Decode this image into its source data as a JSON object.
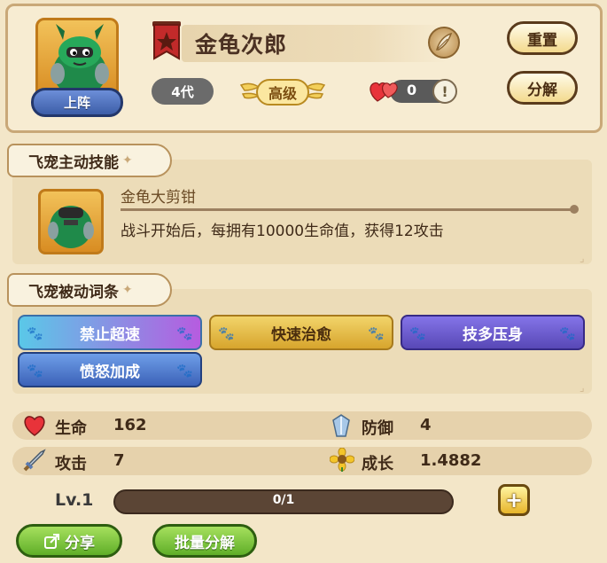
{
  "pet": {
    "name": "金龟次郎",
    "generation": "4代",
    "grade": "高级",
    "hearts": "0",
    "info_symbol": "!"
  },
  "buttons": {
    "deploy": "上阵",
    "reset": "重置",
    "decompose": "分解",
    "share": "分享",
    "batch_decompose": "批量分解",
    "plus": "+"
  },
  "active_skill": {
    "section_title": "飞宠主动技能",
    "name": "金龟大剪钳",
    "description": "战斗开始后，每拥有10000生命值，获得12攻击"
  },
  "passive": {
    "section_title": "飞宠被动词条",
    "traits": [
      {
        "label": "禁止超速",
        "style": "cyan-purple"
      },
      {
        "label": "快速治愈",
        "style": "gold"
      },
      {
        "label": "技多压身",
        "style": "purple"
      },
      {
        "label": "愤怒加成",
        "style": "blue"
      }
    ]
  },
  "stats": {
    "hp_label": "生命",
    "hp_value": "162",
    "def_label": "防御",
    "def_value": "4",
    "atk_label": "攻击",
    "atk_value": "7",
    "growth_label": "成长",
    "growth_value": "1.4882"
  },
  "level": {
    "label": "Lv.1",
    "progress_text": "0/1",
    "progress_fraction": 0
  },
  "colors": {
    "background": "#f3e6c8",
    "panel": "#ecdcb8",
    "accent_gold": "#e7b52a",
    "button_green": "#5fae28"
  },
  "icons": [
    "rank-flag-icon",
    "quill-icon",
    "heart-icon",
    "info-icon",
    "paw-icon",
    "hp-heart-icon",
    "shield-icon",
    "sword-icon",
    "sunflower-icon",
    "share-icon",
    "plus-icon"
  ]
}
